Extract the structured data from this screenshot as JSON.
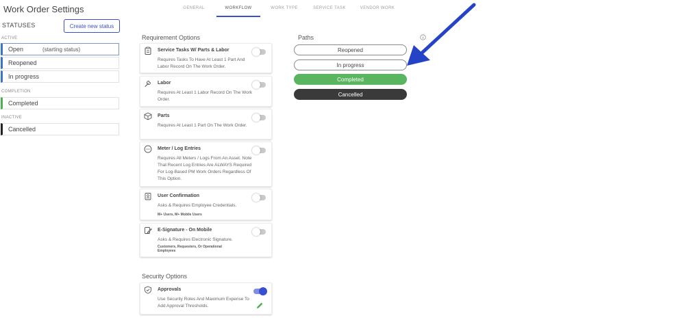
{
  "page": {
    "title": "Work Order Settings"
  },
  "tabs": [
    {
      "label": "GENERAL"
    },
    {
      "label": "WORKFLOW",
      "active": true
    },
    {
      "label": "WORK TYPE"
    },
    {
      "label": "SERVICE TASK"
    },
    {
      "label": "VENDOR WORK"
    }
  ],
  "statuses": {
    "heading": "STATUSES",
    "create_label": "Create new status",
    "groups": {
      "active": "ACTIVE",
      "completion": "COMPLETION",
      "inactive": "INACTIVE"
    },
    "items": [
      {
        "label": "Open",
        "note": "(starting status)"
      },
      {
        "label": "Reopened"
      },
      {
        "label": "In progress"
      },
      {
        "label": "Completed"
      },
      {
        "label": "Cancelled"
      }
    ]
  },
  "requirements": {
    "title": "Requirement Options",
    "cards": [
      {
        "title": "Service Tasks W/ Parts & Labor",
        "desc": "Requires Tasks To Have At Least 1 Part And Labor Record On The Work Order.",
        "enabled": false,
        "icon": "clipboard-icon"
      },
      {
        "title": "Labor",
        "desc": "Requires At Least 1 Labor Record On The Work Order.",
        "enabled": false,
        "icon": "wrench-icon"
      },
      {
        "title": "Parts",
        "desc": "Requires At Least 1 Part On The Work Order.",
        "enabled": false,
        "icon": "box-icon"
      },
      {
        "title": "Meter / Log Entries",
        "desc": "Requires All Meters / Logs From An Asset. Note That Recent Log Entries Are ALWAYS Required For Log-Based PM Work Orders Regardless Of This Option.",
        "enabled": false,
        "icon": "gauge-icon"
      },
      {
        "title": "User Confirmation",
        "desc": "Asks & Requires Employee Credentials.",
        "note": "M+ Users, M+ Mobile Users",
        "enabled": false,
        "icon": "id-badge-icon"
      },
      {
        "title": "E-Signature - On Mobile",
        "desc": "Asks & Requires Electronic Signature.",
        "note": "Customers, Requesters, Or Operational Employees",
        "enabled": false,
        "icon": "signature-icon"
      }
    ]
  },
  "security": {
    "title": "Security Options",
    "card": {
      "title": "Approvals",
      "desc": "Use Security Roles And Maximum Expense To Add Approval Thresholds.",
      "enabled": true,
      "icon": "shield-check-icon"
    }
  },
  "paths": {
    "title": "Paths",
    "items": [
      {
        "label": "Reopened",
        "style": "outline"
      },
      {
        "label": "In progress",
        "style": "outline"
      },
      {
        "label": "Completed",
        "style": "green",
        "color": "#59b560"
      },
      {
        "label": "Cancelled",
        "style": "dark",
        "color": "#3a3a3a"
      }
    ]
  },
  "colors": {
    "accent": "#3a4fcf",
    "arrow": "#2443c7"
  }
}
